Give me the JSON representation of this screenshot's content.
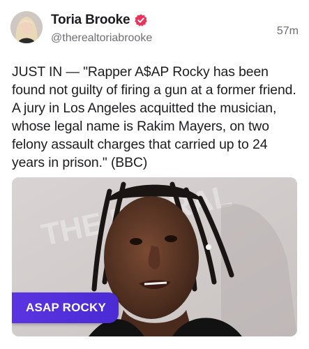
{
  "author": {
    "display_name": "Toria Brooke",
    "handle": "@therealtoriabrooke",
    "verified": true,
    "avatar": "avatar-photo"
  },
  "timestamp": "57m",
  "text": "JUST IN — \"Rapper A$AP Rocky has been found not guilty of firing a gun at a former friend. A jury in Los Angeles acquitted the musician, whose legal name is Rakim Mayers, on two felony assault charges that carried up to 24 years in prison.\" (BBC)",
  "media": {
    "badge_label": "ASAP ROCKY",
    "background_text": "THE DIA RAL",
    "badge_color": "#5a34e0",
    "verified_color": "#e8345c"
  }
}
